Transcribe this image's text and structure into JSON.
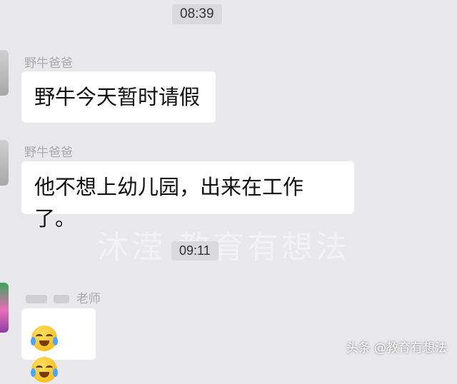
{
  "timestamps": [
    "08:39",
    "09:11"
  ],
  "messages": [
    {
      "sender": "野牛爸爸",
      "text": "野牛今天暂时请假"
    },
    {
      "sender": "野牛爸爸",
      "text": "他不想上幼儿园，出来在工作了。"
    },
    {
      "sender": "老师",
      "text": ""
    }
  ],
  "emoji_names": [
    "face-with-tears-of-joy-icon",
    "face-with-tears-of-joy-icon"
  ],
  "watermark": "沐滢 教育有想法",
  "footer_watermark": "头条 @教育有想法"
}
